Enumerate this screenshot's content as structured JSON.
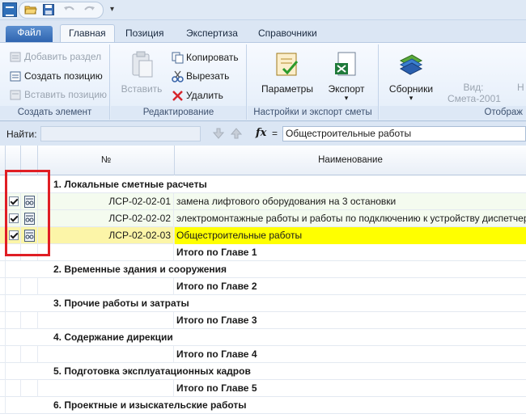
{
  "tabs": [
    "Файл",
    "Главная",
    "Позиция",
    "Экспертиза",
    "Справочники"
  ],
  "ribbon": {
    "create_group": {
      "label": "Создать элемент",
      "add_section": "Добавить раздел",
      "create_position": "Создать позицию",
      "insert_position": "Вставить позицию"
    },
    "edit_group": {
      "label": "Редактирование",
      "paste": "Вставить",
      "copy": "Копировать",
      "cut": "Вырезать",
      "delete": "Удалить"
    },
    "settings_group": {
      "label": "Настройки и экспорт сметы",
      "parameters": "Параметры",
      "export": "Экспорт"
    },
    "display_group": {
      "label": "Отображ",
      "collections": "Сборники",
      "view_label": "Вид:",
      "view_value": "Смета-2001",
      "cut_label": "Н"
    }
  },
  "formula_bar": {
    "find_label": "Найти:",
    "fx": "fx",
    "eq": "=",
    "value": "Общестроительные работы"
  },
  "grid": {
    "headers": {
      "num": "№",
      "name": "Наименование"
    },
    "rows": [
      {
        "type": "section",
        "text": "1. Локальные сметные расчеты"
      },
      {
        "type": "item",
        "num": "ЛСР-02-02-01",
        "name": "замена лифтового оборудования на 3 остановки",
        "checked": true
      },
      {
        "type": "item",
        "num": "ЛСР-02-02-02",
        "name": "электромонтажные работы и работы по подключению к устройству диспетчерской связи",
        "checked": true
      },
      {
        "type": "item-selected",
        "num": "ЛСР-02-02-03",
        "name": "Общестроительные работы",
        "checked": true
      },
      {
        "type": "total",
        "text": "Итого по Главе 1"
      },
      {
        "type": "section",
        "text": "2. Временные здания и сооружения"
      },
      {
        "type": "total",
        "text": "Итого по Главе 2"
      },
      {
        "type": "section",
        "text": "3. Прочие работы и затраты"
      },
      {
        "type": "total",
        "text": "Итого по Главе 3"
      },
      {
        "type": "section",
        "text": "4. Содержание дирекции"
      },
      {
        "type": "total",
        "text": "Итого по Главе 4"
      },
      {
        "type": "section",
        "text": "5. Подготовка эксплуатационных кадров"
      },
      {
        "type": "total",
        "text": "Итого по Главе 5"
      },
      {
        "type": "section",
        "text": "6. Проектные и изыскательские работы"
      }
    ]
  },
  "colors": {
    "highlight": "#ffff00",
    "annotation_box": "#e01e24",
    "file_tab": "#2f65b0"
  }
}
